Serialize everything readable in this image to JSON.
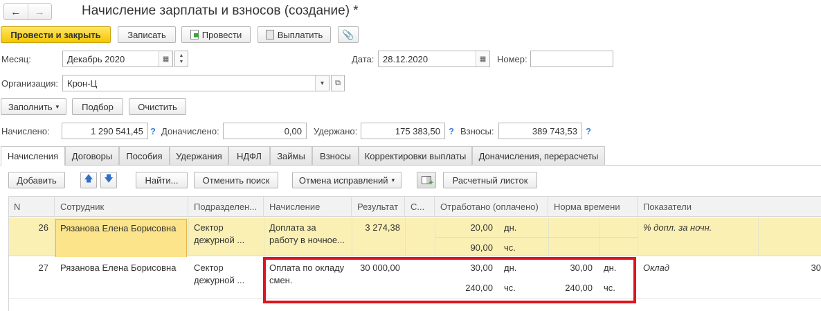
{
  "window": {
    "title": "Начисление зарплаты и взносов (создание) *"
  },
  "toolbar": {
    "post_close": "Провести и закрыть",
    "save": "Записать",
    "post": "Провести",
    "pay": "Выплатить"
  },
  "form": {
    "month_label": "Месяц:",
    "month_value": "Декабрь 2020",
    "date_label": "Дата:",
    "date_value": "28.12.2020",
    "number_label": "Номер:",
    "number_value": "",
    "org_label": "Организация:",
    "org_value": "Крон-Ц"
  },
  "actions": {
    "fill": "Заполнить",
    "select": "Подбор",
    "clear": "Очистить"
  },
  "totals": {
    "accrued_label": "Начислено:",
    "accrued_value": "1 290 541,45",
    "extra_label": "Доначислено:",
    "extra_value": "0,00",
    "withheld_label": "Удержано:",
    "withheld_value": "175 383,50",
    "contrib_label": "Взносы:",
    "contrib_value": "389 743,53",
    "help": "?"
  },
  "tabs": [
    "Начисления",
    "Договоры",
    "Пособия",
    "Удержания",
    "НДФЛ",
    "Займы",
    "Взносы",
    "Корректировки выплаты",
    "Доначисления, перерасчеты"
  ],
  "grid_toolbar": {
    "add": "Добавить",
    "find": "Найти...",
    "cancel_search": "Отменить поиск",
    "cancel_corrections": "Отмена исправлений",
    "payslip": "Расчетный листок"
  },
  "columns": [
    "N",
    "Сотрудник",
    "Подразделен...",
    "Начисление",
    "Результат",
    "С...",
    "Отработано (оплачено)",
    "Норма времени",
    "Показатели"
  ],
  "rows": [
    {
      "n": "26",
      "employee": "Рязанова Елена Борисовна",
      "dept_1": "Сектор",
      "dept_2": "дежурной ...",
      "accrual_1": "Доплата за",
      "accrual_2": "работу в ночное...",
      "result": "3 274,38",
      "worked_days": "20,00",
      "worked_days_unit": "дн.",
      "worked_hours": "90,00",
      "worked_hours_unit": "чс.",
      "norm_days": "",
      "norm_days_unit": "",
      "norm_hours": "",
      "norm_hours_unit": "",
      "indicator": "% допл. за ночн.",
      "indicator_value": ""
    },
    {
      "n": "27",
      "employee": "Рязанова Елена Борисовна",
      "dept_1": "Сектор",
      "dept_2": "дежурной ...",
      "accrual_1": "Оплата по окладу",
      "accrual_2": "смен.",
      "result": "30 000,00",
      "worked_days": "30,00",
      "worked_days_unit": "дн.",
      "worked_hours": "240,00",
      "worked_hours_unit": "чс.",
      "norm_days": "30,00",
      "norm_days_unit": "дн.",
      "norm_hours": "240,00",
      "norm_hours_unit": "чс.",
      "indicator": "Оклад",
      "indicator_value": "30"
    }
  ],
  "colors": {
    "primary_button": "#f5c800",
    "selected_row": "#fbf0b4",
    "highlight_box": "#e0141e",
    "help": "#3b7ed6"
  }
}
